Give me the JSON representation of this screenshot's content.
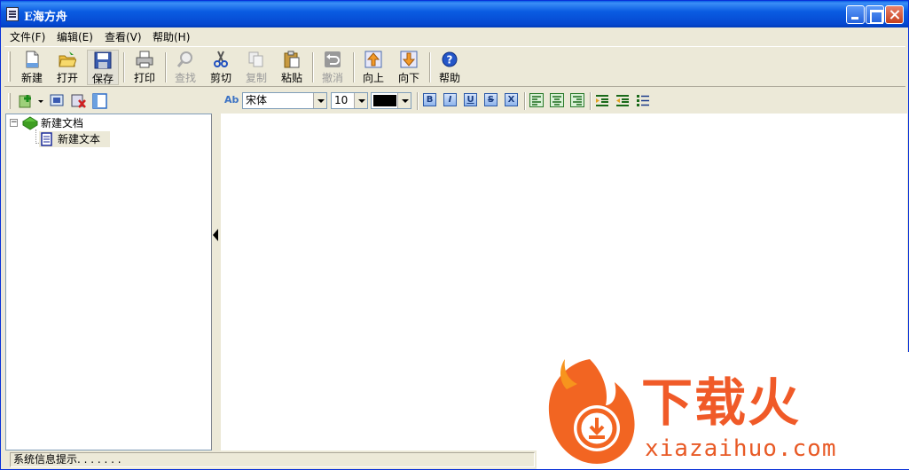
{
  "window": {
    "title": "E海方舟"
  },
  "menu": {
    "file": "文件(F)",
    "edit": "编辑(E)",
    "view": "查看(V)",
    "help": "帮助(H)"
  },
  "toolbar": {
    "new": "新建",
    "open": "打开",
    "save": "保存",
    "print": "打印",
    "find": "查找",
    "cut": "剪切",
    "copy": "复制",
    "paste": "粘贴",
    "undo": "撤消",
    "up": "向上",
    "down": "向下",
    "help": "帮助"
  },
  "tree": {
    "root": "新建文档",
    "child": "新建文本"
  },
  "format": {
    "ab_label": "Ab",
    "font": "宋体",
    "size": "10",
    "text_color": "#000000",
    "bold": "B",
    "italic": "I",
    "underline": "U",
    "strike": "S",
    "clear": "X"
  },
  "status": {
    "text": "系统信息提示. . . . . . ."
  },
  "watermark": {
    "brand": "下载火",
    "url": "xiazaihuo.com"
  }
}
